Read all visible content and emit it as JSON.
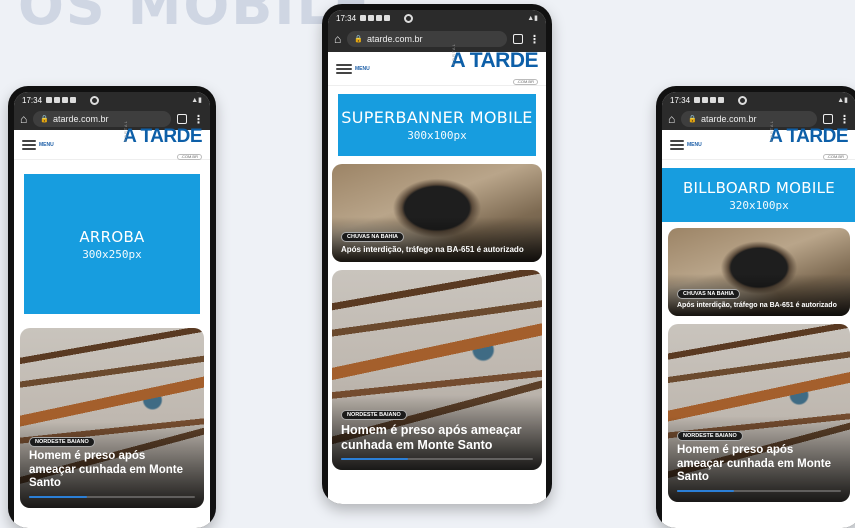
{
  "page_heading": "OS MOBILE",
  "phones": [
    {
      "status_time": "17:34",
      "url": "atarde.com.br",
      "menu_label": "MENU",
      "logo": {
        "portal": "PORTAL",
        "brand": "A TARDE",
        "domain": ".COM.BR"
      },
      "ad": {
        "name": "ARROBA",
        "size": "300x250px"
      },
      "cards": [
        {
          "badge": "NORDESTE BAIANO",
          "headline": "Homem é preso após ameaçar cunhada em Monte Santo",
          "progress": 0.35
        }
      ]
    },
    {
      "status_time": "17:34",
      "url": "atarde.com.br",
      "menu_label": "MENU",
      "logo": {
        "portal": "PORTAL",
        "brand": "A TARDE",
        "domain": ".COM.BR"
      },
      "ad": {
        "name": "SUPERBANNER MOBILE",
        "size": "300x100px"
      },
      "cards": [
        {
          "badge": "CHUVAS NA BAHIA",
          "headline": "Após interdição, tráfego na BA-651 é autorizado"
        },
        {
          "badge": "NORDESTE BAIANO",
          "headline": "Homem é preso após ameaçar cunhada em Monte Santo",
          "progress": 0.35
        }
      ]
    },
    {
      "status_time": "17:34",
      "url": "atarde.com.br",
      "menu_label": "MENU",
      "logo": {
        "portal": "PORTAL",
        "brand": "A TARDE",
        "domain": ".COM.BR"
      },
      "ad": {
        "name": "BILLBOARD MOBILE",
        "size": "320x100px"
      },
      "cards": [
        {
          "badge": "CHUVAS NA BAHIA",
          "headline": "Após interdição, tráfego na BA-651 é autorizado"
        },
        {
          "badge": "NORDESTE BAIANO",
          "headline": "Homem é preso após ameaçar cunhada em Monte Santo",
          "progress": 0.35
        }
      ]
    }
  ]
}
